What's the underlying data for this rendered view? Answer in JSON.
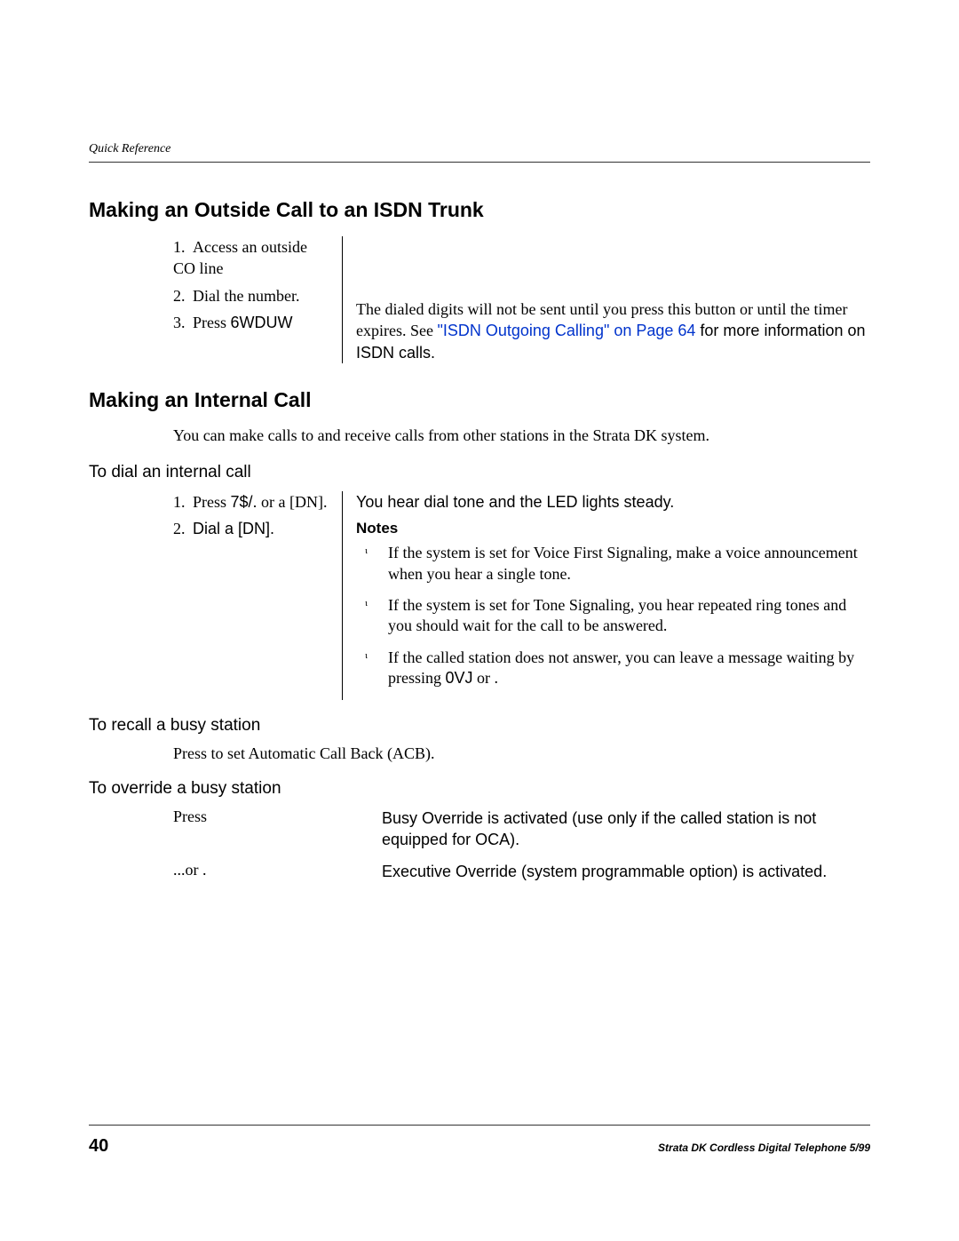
{
  "running_header": "Quick Reference",
  "h1": "Making an Outside Call to an ISDN Trunk",
  "isdn": {
    "step1_num": "1.",
    "step1_text": "Access an outside CO line",
    "step2_num": "2.",
    "step2_text": "Dial the number.",
    "step3_num": "3.",
    "step3_prefix": "Press ",
    "step3_key": "6WDUW",
    "right_a": "The dialed digits will not be sent until you press this button or until the timer expires. See ",
    "right_link": "\"ISDN Outgoing Calling\" on Page 64",
    "right_b": " for more information on ISDN calls."
  },
  "h2": "Making an Internal Call",
  "intro": "You can make calls to and receive calls from other stations in the Strata DK system.",
  "sub1": "To dial an internal call",
  "dial": {
    "step1_num": "1.",
    "step1_a": "Press ",
    "step1_key": "7$/.",
    "step1_b": "   or a [DN].",
    "step2_num": "2.",
    "step2_text": "Dial a [DN].",
    "right1": "You hear dial tone and the LED lights steady.",
    "notes_label": "Notes",
    "note1": "If the system is set for Voice First Signaling, make a voice announcement when you hear a single tone.",
    "note2": "If the system is set for Tone Signaling, you hear repeated ring tones and you should wait for the call to be answered.",
    "note3_a": "If the called station does not answer, you can leave a message waiting by pressing ",
    "note3_key": "0VJ",
    "note3_b": " or  ."
  },
  "sub2": "To recall a busy station",
  "recall": "Press   to set Automatic Call Back (ACB).",
  "sub3": "To override a busy station",
  "override": {
    "left1": "Press ",
    "right1": "Busy Override is activated (use only if the called station is not equipped for OCA).",
    "left2": "...or  .",
    "right2": "Executive Override (system programmable option) is activated."
  },
  "footer": {
    "page": "40",
    "title": "Strata DK Cordless Digital Telephone 5/99"
  }
}
